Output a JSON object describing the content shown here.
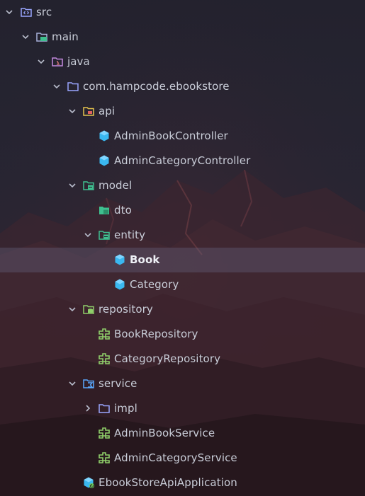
{
  "colors": {
    "folder": "#9aa6ff",
    "folder_api": "#e6c34d",
    "folder_green": "#3fbf8f",
    "class_blue": "#3ab8f0",
    "interface_green": "#8fcf6a",
    "text": "#c9cdd8",
    "selected_bg": "#3a3a4a"
  },
  "tree": [
    {
      "label": "src",
      "icon": "source-folder-icon",
      "expanded": true
    },
    {
      "label": "main",
      "icon": "module-folder-icon",
      "expanded": true
    },
    {
      "label": "java",
      "icon": "java-source-root-icon",
      "expanded": true
    },
    {
      "label": "com.hampcode.ebookstore",
      "icon": "package-folder-icon",
      "expanded": true
    },
    {
      "label": "api",
      "icon": "api-package-icon",
      "expanded": true
    },
    {
      "label": "AdminBookController",
      "icon": "class-icon"
    },
    {
      "label": "AdminCategoryController",
      "icon": "class-icon"
    },
    {
      "label": "model",
      "icon": "model-package-icon",
      "expanded": true
    },
    {
      "label": "dto",
      "icon": "dto-package-icon"
    },
    {
      "label": "entity",
      "icon": "entity-package-icon",
      "expanded": true
    },
    {
      "label": "Book",
      "icon": "class-icon",
      "selected": true
    },
    {
      "label": "Category",
      "icon": "class-icon"
    },
    {
      "label": "repository",
      "icon": "repository-package-icon",
      "expanded": true
    },
    {
      "label": "BookRepository",
      "icon": "interface-icon"
    },
    {
      "label": "CategoryRepository",
      "icon": "interface-icon"
    },
    {
      "label": "service",
      "icon": "service-package-icon",
      "expanded": true
    },
    {
      "label": "impl",
      "icon": "package-folder-icon",
      "expanded": false
    },
    {
      "label": "AdminBookService",
      "icon": "interface-icon"
    },
    {
      "label": "AdminCategoryService",
      "icon": "interface-icon"
    },
    {
      "label": "EbookStoreApiApplication",
      "icon": "spring-boot-application-icon"
    }
  ]
}
